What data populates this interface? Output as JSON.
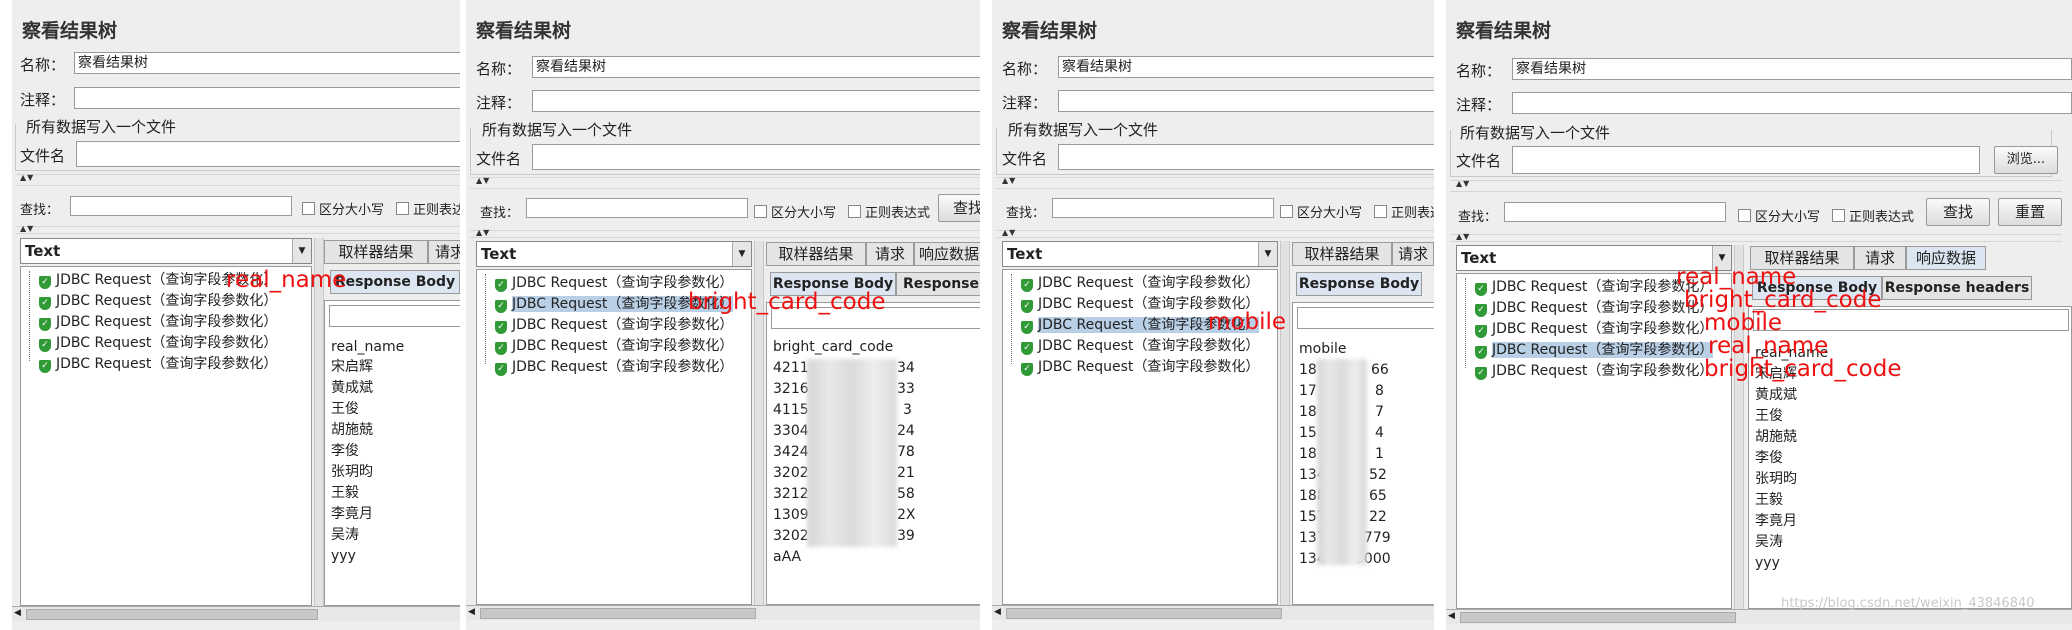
{
  "common": {
    "title": "察看结果树",
    "name_label": "名称：",
    "name_value": "察看结果树",
    "comment_label": "注释：",
    "file_group": "所有数据写入一个文件",
    "file_label": "文件名",
    "browse": "浏览...",
    "search_label": "查找：",
    "case_sensitive": "区分大小写",
    "regex": "正则表达式",
    "find": "查找",
    "reset": "重置",
    "renderer": "Text",
    "tabs": [
      "取样器结果",
      "请求",
      "响应数据"
    ],
    "subtabs": [
      "Response Body",
      "Response headers"
    ],
    "tree_items": [
      "JDBC Request（查询字段参数化）",
      "JDBC Request（查询字段参数化）",
      "JDBC Request（查询字段参数化）",
      "JDBC Request（查询字段参数化）",
      "JDBC Request（查询字段参数化）"
    ]
  },
  "panel1": {
    "regex_cut": "正则表达",
    "tab2_cut": "请求",
    "response": [
      "real_name",
      "宋启辉",
      "黄成斌",
      "王俊",
      "胡施兢",
      "李俊",
      "张玥昀",
      "王毅",
      "李竟月",
      "吴涛",
      "yyy"
    ],
    "annotation": "real_name"
  },
  "panel2": {
    "find_cut": "查找",
    "tab3_cut": "响应数据",
    "subtab2_cut": "Response",
    "response": [
      "bright_card_code",
      "4211",
      "3216",
      "4115",
      "3304",
      "3424",
      "3202",
      "3212",
      "1309",
      "3202",
      "aAA"
    ],
    "response_tail": [
      "34",
      "33",
      "3",
      "24",
      "78",
      "21",
      "58",
      "2X",
      "39"
    ],
    "annotation": "bright_card_code"
  },
  "panel3": {
    "regex_cut": "正则表达",
    "tab2_cut": "请求",
    "response": [
      "mobile",
      "18",
      "17",
      "18",
      "15",
      "18",
      "134",
      "188",
      "157",
      "137",
      "134"
    ],
    "response_tail": [
      "66",
      "8",
      "7",
      "4",
      "1",
      "52",
      "65",
      "22",
      "3779",
      "0000"
    ],
    "annotation": "mobile"
  },
  "panel4": {
    "response": [
      "real_name",
      "宋启辉",
      "黄成斌",
      "王俊",
      "胡施兢",
      "李俊",
      "张玥昀",
      "王毅",
      "李竟月",
      "吴涛",
      "yyy"
    ],
    "annotations": [
      "real_name",
      "bright_card_code",
      "mobile",
      "real_name",
      "bright_card_code"
    ],
    "watermark": "https://blog.csdn.net/weixin_43846840"
  }
}
